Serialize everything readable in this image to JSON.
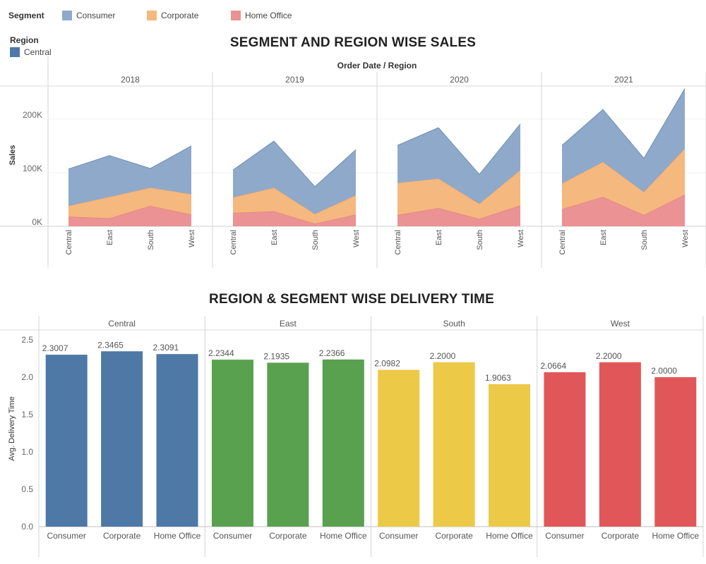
{
  "legend": {
    "segment_title": "Segment",
    "segments": [
      {
        "label": "Consumer",
        "color": "#8fa9ca"
      },
      {
        "label": "Corporate",
        "color": "#f5b87e"
      },
      {
        "label": "Home Office",
        "color": "#ea9294"
      }
    ],
    "region_title": "Region",
    "regions": [
      {
        "label": "Central",
        "color": "#4e79a7"
      }
    ]
  },
  "chart_data": [
    {
      "type": "area",
      "title": "SEGMENT AND REGION WISE SALES",
      "header": "Order Date / Region",
      "ylabel": "Sales",
      "ylim": [
        0,
        260000
      ],
      "yticks": [
        {
          "value": 0,
          "label": "0K"
        },
        {
          "value": 100000,
          "label": "100K"
        },
        {
          "value": 200000,
          "label": "200K"
        }
      ],
      "stacked": true,
      "years": [
        "2018",
        "2019",
        "2020",
        "2021"
      ],
      "categories": [
        "Central",
        "East",
        "South",
        "West"
      ],
      "series": [
        {
          "name": "Home Office",
          "color": "#ea9294",
          "line": "#e07b7e",
          "values": [
            [
              18000,
              15000,
              38000,
              22000
            ],
            [
              25000,
              28000,
              5000,
              22000
            ],
            [
              21000,
              34000,
              14000,
              39000
            ],
            [
              32000,
              55000,
              21000,
              59000
            ]
          ]
        },
        {
          "name": "Corporate",
          "color": "#f5b87e",
          "line": "#eda563",
          "values": [
            [
              20000,
              40000,
              34000,
              38000
            ],
            [
              29000,
              44000,
              18000,
              36000
            ],
            [
              60000,
              55000,
              28000,
              66000
            ],
            [
              48000,
              65000,
              43000,
              86000
            ]
          ]
        },
        {
          "name": "Consumer",
          "color": "#8fa9ca",
          "line": "#6d8db5",
          "values": [
            [
              69000,
              77000,
              36000,
              90000
            ],
            [
              51000,
              87000,
              51000,
              85000
            ],
            [
              70000,
              95000,
              55000,
              86000
            ],
            [
              71000,
              98000,
              63000,
              112000
            ]
          ]
        }
      ]
    },
    {
      "type": "bar",
      "title": "REGION & SEGMENT WISE DELIVERY TIME",
      "ylabel": "Avg. Delivery Time",
      "ylim": [
        0,
        2.5
      ],
      "yticks": [
        0.0,
        0.5,
        1.0,
        1.5,
        2.0,
        2.5
      ],
      "ytick_labels": [
        "0.0",
        "0.5",
        "1.0",
        "1.5",
        "2.0",
        "2.5"
      ],
      "groups": [
        {
          "name": "Central",
          "color": "#4e79a7",
          "categories": [
            "Consumer",
            "Corporate",
            "Home Office"
          ],
          "values": [
            2.3007,
            2.3465,
            2.3091
          ],
          "labels": [
            "2.3007",
            "2.3465",
            "2.3091"
          ]
        },
        {
          "name": "East",
          "color": "#59a14f",
          "categories": [
            "Consumer",
            "Corporate",
            "Home Office"
          ],
          "values": [
            2.2344,
            2.1935,
            2.2366
          ],
          "labels": [
            "2.2344",
            "2.1935",
            "2.2366"
          ]
        },
        {
          "name": "South",
          "color": "#edc948",
          "categories": [
            "Consumer",
            "Corporate",
            "Home Office"
          ],
          "values": [
            2.0982,
            2.2,
            1.9063
          ],
          "labels": [
            "2.0982",
            "2.2000",
            "1.9063"
          ]
        },
        {
          "name": "West",
          "color": "#e15759",
          "categories": [
            "Consumer",
            "Corporate",
            "Home Office"
          ],
          "values": [
            2.0664,
            2.2,
            2.0
          ],
          "labels": [
            "2.0664",
            "2.2000",
            "2.0000"
          ]
        }
      ]
    }
  ]
}
